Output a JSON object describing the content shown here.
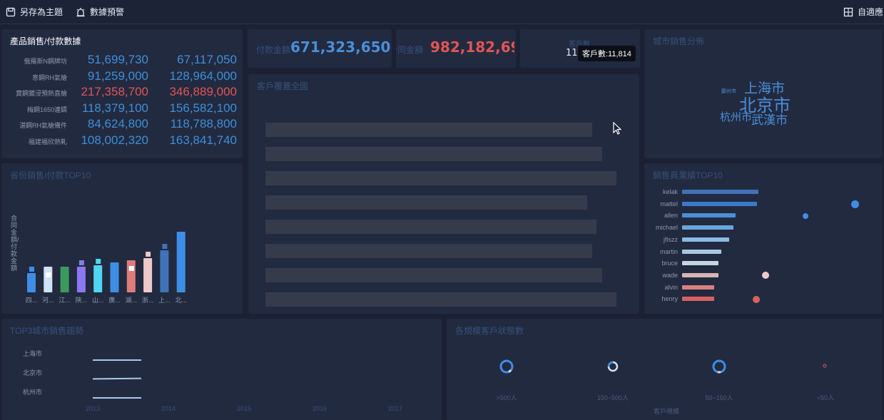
{
  "toolbar": {
    "save_theme": "另存為主題",
    "data_alert": "數據預警",
    "auto_fit": "自適應"
  },
  "product_panel": {
    "title": "產品銷售/付款數據",
    "rows": [
      {
        "name": "俄羅斯N鋼牌坊",
        "v1": "51,699,730",
        "v2": "67,117,050",
        "color": "#3e8fd6"
      },
      {
        "name": "意鋼RH氣槍",
        "v1": "91,259,000",
        "v2": "128,964,000",
        "color": "#3e8fd6"
      },
      {
        "name": "寶鋼鍍浸預熱直槍",
        "v1": "217,358,700",
        "v2": "346,889,000",
        "color": "#e05555"
      },
      {
        "name": "梅鋼1650連鑄",
        "v1": "118,379,100",
        "v2": "156,582,100",
        "color": "#3e8fd6"
      },
      {
        "name": "湛鋼RH氣槍備件",
        "v1": "84,624,800",
        "v2": "118,788,800",
        "color": "#3e8fd6"
      },
      {
        "name": "福建福欣熱軋",
        "v1": "108,002,320",
        "v2": "163,841,740",
        "color": "#3e8fd6"
      }
    ]
  },
  "kpis": {
    "payment_label": "付款金額",
    "payment_value": "671,323,650",
    "contract_label": "合同金額",
    "contract_value": "982,182,690",
    "customers_label": "客戶數",
    "customers_value": "11,",
    "tooltip": "客戶數:11,814"
  },
  "map_panel": {
    "title": "客戶覆蓋全國"
  },
  "city_panel": {
    "title": "城市銷售分佈",
    "words": [
      "上海市",
      "北京市",
      "杭州市",
      "武漢市",
      "鄭州市"
    ]
  },
  "province_panel": {
    "title": "省份銷售/付款TOP10",
    "ylabel": "合同金額/付款金額"
  },
  "province_chart_data": {
    "type": "bar",
    "categories": [
      "四...",
      "河...",
      "江...",
      "陝...",
      "山...",
      "廣...",
      "湖...",
      "浙...",
      "上...",
      "北..."
    ],
    "colors": [
      "#3f8ee6",
      "#cfe3f5",
      "#3a9a5c",
      "#8a79f0",
      "#4fd6f0",
      "#3f8ee6",
      "#e07b7b",
      "#eec9c9",
      "#3f72b8",
      "#3f8ee6"
    ],
    "values": [
      27,
      36,
      36,
      36,
      38,
      42,
      45,
      48,
      59,
      85
    ],
    "payments": [
      5,
      5,
      0,
      5,
      5,
      0,
      5,
      5,
      6,
      0
    ],
    "ylim": [
      0,
      100
    ]
  },
  "sales_panel": {
    "title": "銷售員業績TOP10"
  },
  "sales_chart_data": {
    "type": "bar",
    "categories": [
      "kelak",
      "mattel",
      "allen",
      "michael",
      "jfiszz",
      "martin",
      "bruce",
      "wade",
      "alvin",
      "henry"
    ],
    "values": [
      107,
      105,
      75,
      72,
      66,
      55,
      51,
      51,
      45,
      45
    ],
    "colors": [
      "#3f72b8",
      "#3a7acc",
      "#4a8ed8",
      "#6aa6de",
      "#8bb9e4",
      "#a8c8e2",
      "#c5d4e0",
      "#d8b4b4",
      "#d88080",
      "#d86060"
    ],
    "xlim": [
      0,
      320
    ]
  },
  "trend_panel": {
    "title": "TOP3城市銷售趨勢",
    "cities": [
      "上海市",
      "北京市",
      "杭州市"
    ],
    "years": [
      "2013",
      "2014",
      "2015",
      "2016",
      "2017"
    ]
  },
  "donut_panel": {
    "title": "各規模客戶狀態數",
    "categories": [
      ">500人",
      "150~500人",
      "50~150人",
      "<50人"
    ],
    "xlabel": "客戶規模"
  }
}
